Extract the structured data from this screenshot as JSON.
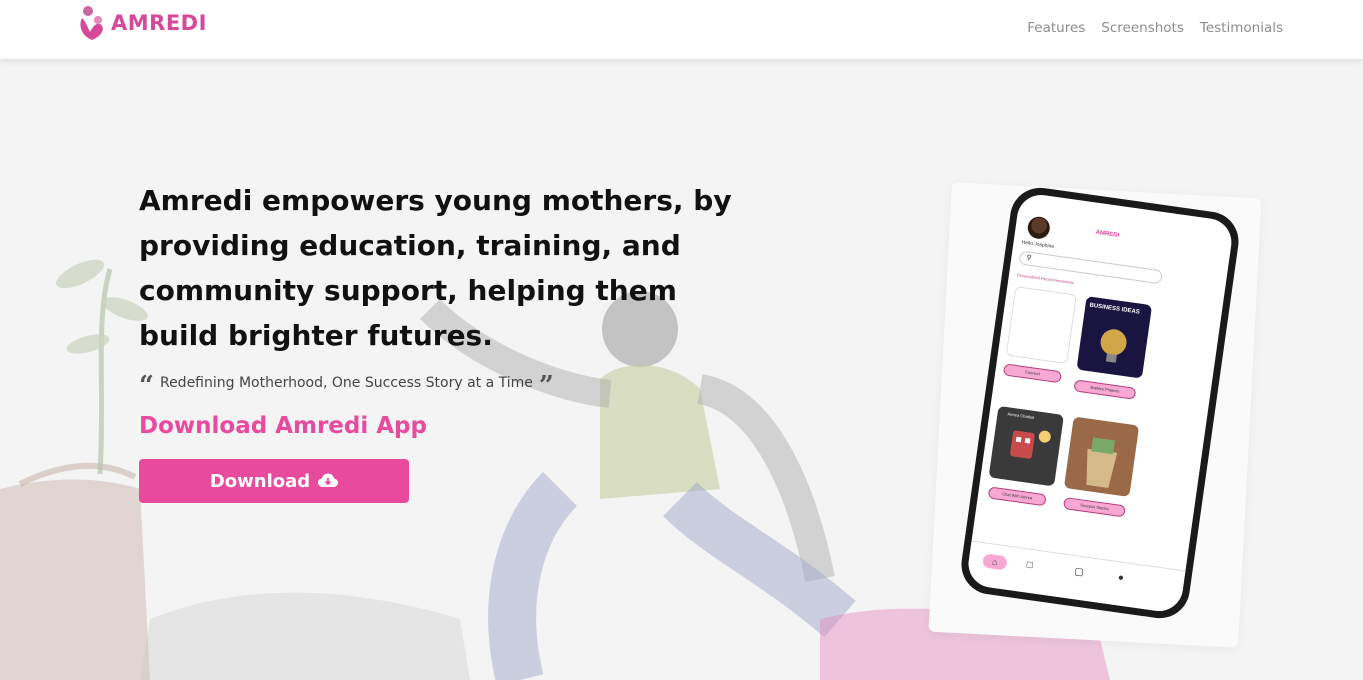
{
  "brand": {
    "name": "AMREDI",
    "color": "#d6489a"
  },
  "nav": {
    "links": [
      "Features",
      "Screenshots",
      "Testimonials"
    ]
  },
  "hero": {
    "headline": "Amredi empowers young mothers, by providing education, training, and community support, helping them build brighter futures.",
    "tagline": "Redefining Motherhood, One Success Story at a Time",
    "download_heading": "Download Amredi App",
    "download_button": "Download",
    "accent_color": "#e84a9e"
  },
  "phone_mockup": {
    "greeting": "Hello Josphine",
    "app_logo": "AMREDI",
    "section_title": "Personalized Recommendations",
    "tile_business_title": "BUSINESS IDEAS",
    "tile_chat_title": "Amrea Chatbot",
    "pills": [
      "Connect",
      "Explore Projects",
      "Chat With Amrea",
      "Success Stories"
    ],
    "nav_icons": [
      "home-icon",
      "folder-icon",
      "chat-icon",
      "user-icon"
    ]
  }
}
